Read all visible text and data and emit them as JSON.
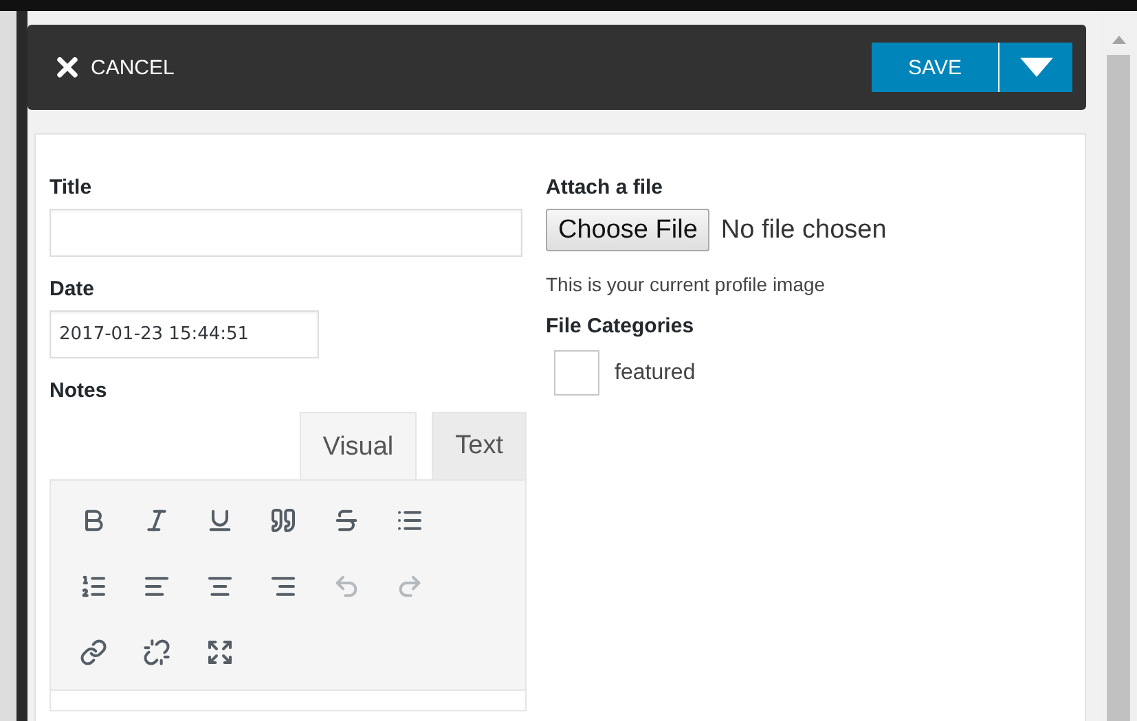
{
  "header": {
    "cancel": "CANCEL",
    "save": "SAVE"
  },
  "title_field": {
    "label": "Title"
  },
  "date_field": {
    "label": "Date",
    "value": "2017-01-23 15:44:51"
  },
  "notes": {
    "label": "Notes",
    "tabs": [
      {
        "label": "Visual",
        "selected": true
      },
      {
        "label": "Text",
        "selected": false
      }
    ],
    "tools": [
      {
        "kind": "bold",
        "disabled": false
      },
      {
        "kind": "italic",
        "disabled": false
      },
      {
        "kind": "underline",
        "disabled": false
      },
      {
        "kind": "quote",
        "disabled": false
      },
      {
        "kind": "strike",
        "disabled": false
      },
      {
        "kind": "bullets",
        "disabled": false
      },
      {
        "kind": "numbers",
        "disabled": false
      },
      {
        "kind": "left",
        "disabled": false
      },
      {
        "kind": "center",
        "disabled": false
      },
      {
        "kind": "right",
        "disabled": false
      },
      {
        "kind": "undo",
        "disabled": true
      },
      {
        "kind": "redo",
        "disabled": true
      },
      {
        "kind": "link",
        "disabled": false
      },
      {
        "kind": "unlink",
        "disabled": false
      },
      {
        "kind": "fullscreen",
        "disabled": false
      }
    ]
  },
  "attach": {
    "label": "Attach a file",
    "button": "Choose File",
    "status": "No file chosen",
    "hint": "This is your current profile image"
  },
  "categories": {
    "label": "File Categories",
    "items": [
      {
        "label": "featured",
        "checked": false
      }
    ]
  }
}
